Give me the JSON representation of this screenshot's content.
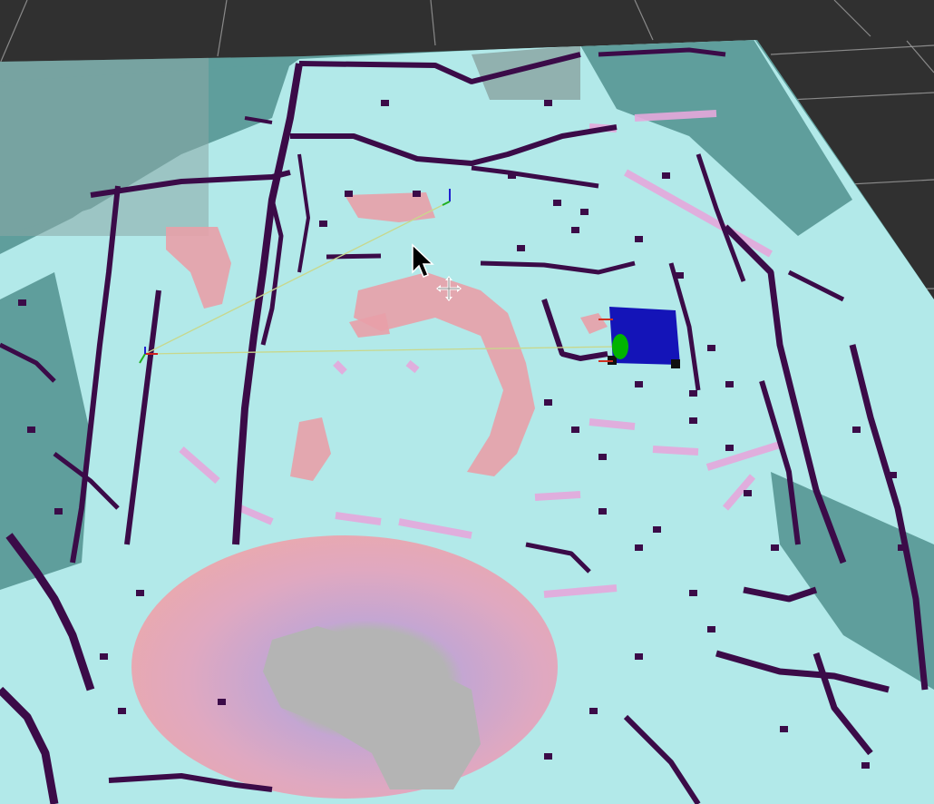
{
  "app": {
    "view": "3D render view",
    "background_color": "#303030",
    "grid_color": "#a0a0a0"
  },
  "costmap": {
    "colors": {
      "free": "#b2e9e9",
      "unknown": "#5f9e9c",
      "lethal": "#3b0b48",
      "inflated": "#e8a0a8",
      "inscribed": "#c4a6d2",
      "no_data": "#b4b4b4"
    }
  },
  "robot": {
    "icon": "robot-footprint-icon",
    "body_color": "#1414b8",
    "heading_marker_color": "#00b400"
  },
  "plan": {
    "line_color": "#c8d88c",
    "start_axes_icon": "axes-icon",
    "goal_axes_icon": "axes-icon"
  },
  "cursor": {
    "pointer_icon": "arrow-cursor-icon",
    "move_icon": "move-cross-icon"
  }
}
